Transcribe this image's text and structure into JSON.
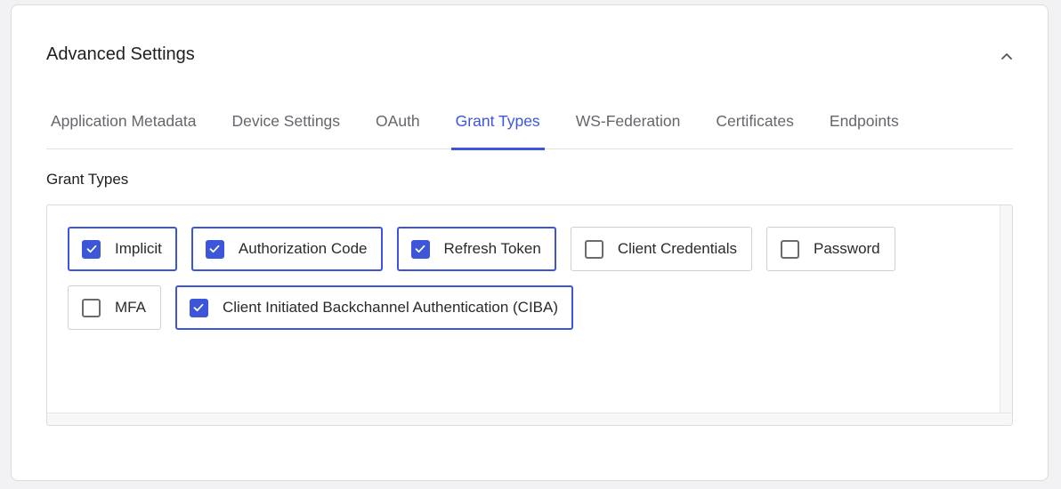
{
  "panel": {
    "title": "Advanced Settings",
    "collapse_icon": "chevron-up-icon"
  },
  "tabs": [
    {
      "label": "Application Metadata",
      "active": false
    },
    {
      "label": "Device Settings",
      "active": false
    },
    {
      "label": "OAuth",
      "active": false
    },
    {
      "label": "Grant Types",
      "active": true
    },
    {
      "label": "WS-Federation",
      "active": false
    },
    {
      "label": "Certificates",
      "active": false
    },
    {
      "label": "Endpoints",
      "active": false
    }
  ],
  "grant_types": {
    "label": "Grant Types",
    "options": [
      {
        "label": "Implicit",
        "checked": true
      },
      {
        "label": "Authorization Code",
        "checked": true
      },
      {
        "label": "Refresh Token",
        "checked": true
      },
      {
        "label": "Client Credentials",
        "checked": false
      },
      {
        "label": "Password",
        "checked": false
      },
      {
        "label": "MFA",
        "checked": false
      },
      {
        "label": "Client Initiated Backchannel Authentication (CIBA)",
        "checked": true
      }
    ]
  },
  "colors": {
    "accent": "#3d55d9",
    "tab_inactive": "#65666b",
    "border": "#dcdcdc"
  }
}
